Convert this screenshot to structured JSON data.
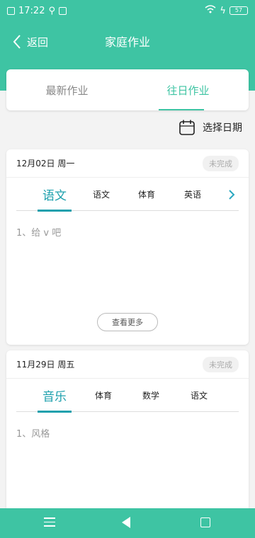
{
  "status_bar": {
    "time": "17:22",
    "battery": "57"
  },
  "header": {
    "back_label": "返回",
    "title": "家庭作业"
  },
  "tabs": [
    {
      "label": "最新作业"
    },
    {
      "label": "往日作业"
    }
  ],
  "date_picker": {
    "label": "选择日期"
  },
  "cards": [
    {
      "date": "12月02日 周一",
      "status": "未完成",
      "subjects": [
        "语文",
        "语文",
        "体育",
        "英语"
      ],
      "content": "1、给 v 吧",
      "more_label": "查看更多"
    },
    {
      "date": "11月29日 周五",
      "status": "未完成",
      "subjects": [
        "音乐",
        "体育",
        "数学",
        "语文"
      ],
      "content": "1、风格"
    }
  ],
  "colors": {
    "primary": "#3ec4a3",
    "subject_active": "#1da0ad"
  }
}
